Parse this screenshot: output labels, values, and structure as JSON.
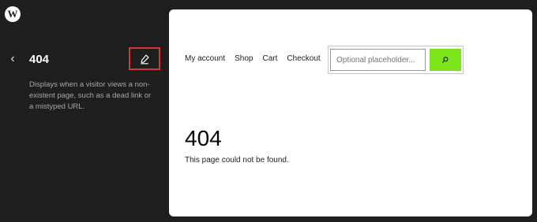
{
  "app": {
    "logo_icon": "wordpress-logo-icon",
    "logo_glyph": "W"
  },
  "sidebar": {
    "back_icon": "chevron-left-icon",
    "back_glyph": "‹",
    "title": "404",
    "edit_icon": "pencil-icon",
    "description": "Displays when a visitor views a non-existent page, such as a dead link or a mistyped URL."
  },
  "preview": {
    "nav_items": [
      "My account",
      "Shop",
      "Cart",
      "Checkout"
    ],
    "search": {
      "placeholder": "Optional placeholder...",
      "value": "",
      "button_icon": "search-icon"
    },
    "heading": "404",
    "message": "This page could not be found."
  },
  "colors": {
    "sidebar_bg": "#1e1e1e",
    "canvas_bg": "#ffffff",
    "search_button": "#7be51a",
    "highlight_border": "#d63638"
  }
}
